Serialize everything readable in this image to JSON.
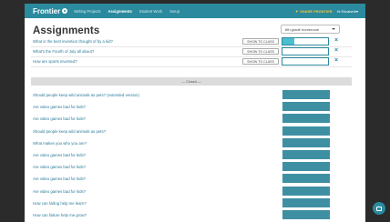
{
  "header": {
    "brand": "Frontier",
    "nav": [
      "Writing Projects",
      "Assignments",
      "Student Work",
      "Setup"
    ],
    "active_nav": "Assignments",
    "share": "SHARE FRONTIER",
    "user": "Hi Elizabeth"
  },
  "page": {
    "title": "Assignments",
    "class_select": "6th grade homeroom"
  },
  "open_assignments": [
    {
      "question": "What is the best invention thought of by a kid?",
      "button": "SHOW TO CLASS",
      "progress": 0.25
    },
    {
      "question": "What's the Fourth of July all about?",
      "button": "SHOW TO CLASS",
      "progress": 0
    },
    {
      "question": "How are sports invented?",
      "button": "SHOW TO CLASS",
      "progress": 0
    }
  ],
  "closed_label": "— Closed —",
  "closed_assignments": [
    "Should people keep wild animals as pets? (extended version)",
    "Are video games bad for kids?",
    "Are video games bad for kids?",
    "Should people keep wild animals as pets?",
    "What makes you who you are?",
    "Are video games bad for kids?",
    "Are video games bad for kids?",
    "Are video games bad for kids?",
    "Are video games bad for kids?",
    "How can failing help me learn?",
    "How can failure help me grow?"
  ],
  "colors": {
    "brand": "#2b8a9e",
    "accent_fill": "#4bbfd0",
    "closed_bar": "#3f8fa3",
    "share": "#f4c542"
  },
  "icons": {
    "remove": "close-icon",
    "dropdown": "chevron-down-icon",
    "chat": "chat-icon"
  }
}
